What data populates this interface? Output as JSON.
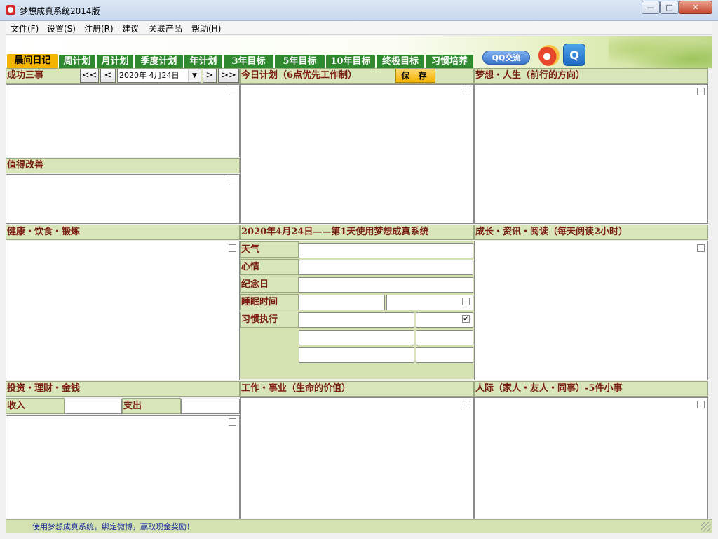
{
  "window": {
    "title": "梦想成真系统2014版",
    "min": "—",
    "max": "□",
    "close": "✕"
  },
  "menu": [
    "文件(F)",
    "设置(S)",
    "注册(R)",
    "建议",
    "关联产品",
    "帮助(H)"
  ],
  "tabs": [
    "晨间日记",
    "周计划",
    "月计划",
    "季度计划",
    "年计划",
    "3年目标",
    "5年目标",
    "10年目标",
    "终极目标",
    "习惯培养"
  ],
  "social": {
    "qq_label": "QQ交流",
    "qq2_label": "Q"
  },
  "sections": {
    "success": "成功三事",
    "improve": "值得改善",
    "today_plan": "今日计划（6点优先工作制）",
    "save": "保 存",
    "dream": "梦想・人生（前行的方向）",
    "health": "健康・饮食・锻炼",
    "diary_header": "2020年4月24日——第1天使用梦想成真系统",
    "growth": "成长・资讯・阅读（每天阅读2小时）",
    "invest": "投资・理财・金钱",
    "work": "工作・事业（生命的价值）",
    "people": "人际（家人・友人・同事）-5件小事"
  },
  "date_nav": {
    "first": "<<",
    "prev": "<",
    "date": "2020年 4月24日",
    "next": ">",
    "last": ">>",
    "dropdown": "▼"
  },
  "diary_rows": {
    "weather": "天气",
    "mood": "心情",
    "anniversary": "纪念日",
    "sleep": "睡眠时间",
    "habit": "习惯执行"
  },
  "money": {
    "income": "收入",
    "expense": "支出"
  },
  "checks": {
    "habit_checked": "✔"
  },
  "status": "使用梦想成真系统，绑定微博，赢取现金奖励！"
}
